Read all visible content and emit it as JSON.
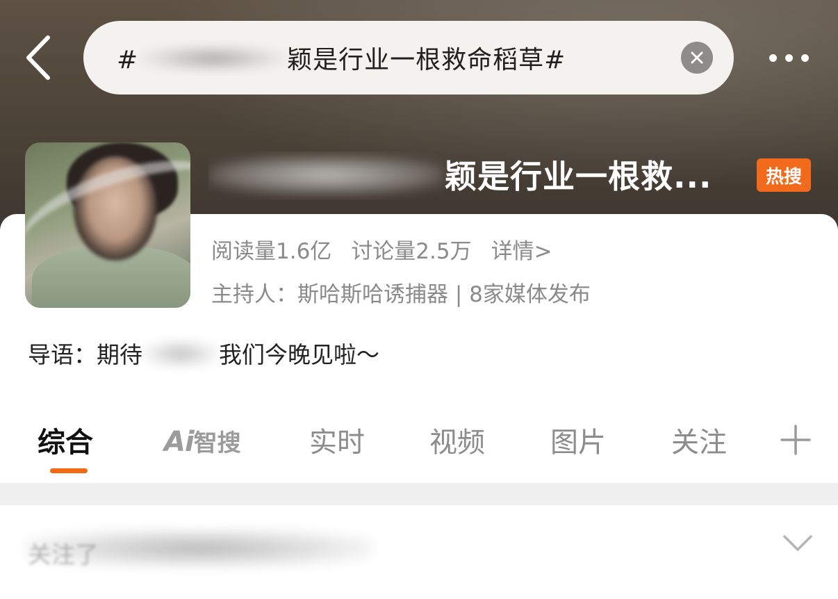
{
  "header": {
    "search_text_prefix": "#",
    "search_text_suffix": "颖是行业一根救命稻草#",
    "topic_title_suffix": "颖是行业一根救...",
    "hot_badge": "热搜"
  },
  "stats": {
    "read_count": "阅读量1.6亿",
    "discuss_count": "讨论量2.5万",
    "detail_link": "详情>"
  },
  "host_line": "主持人：斯哈斯哈诱捕器 | 8家媒体发布",
  "intro": {
    "prefix": "导语：期待",
    "suffix": "我们今晚见啦～"
  },
  "tabs": {
    "comprehensive": "综合",
    "ai_mark": "Ai",
    "ai_word": "智搜",
    "realtime": "实时",
    "video": "视频",
    "images": "图片",
    "follow": "关注"
  },
  "feed": {
    "collapsed_text": "关注了"
  },
  "colors": {
    "accent": "#f36a14",
    "hot_badge": "#f26b1d",
    "secondary_text": "#8a8a8a"
  }
}
